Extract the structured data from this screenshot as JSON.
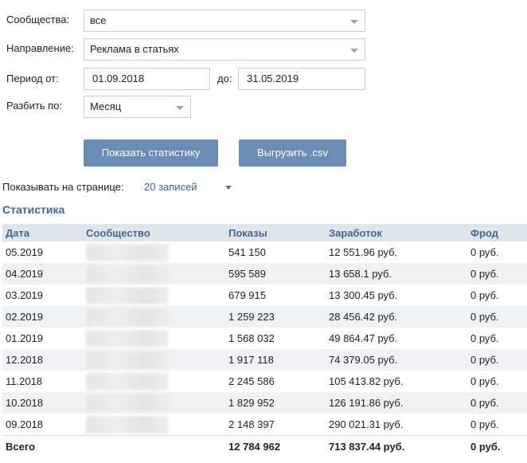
{
  "filters": {
    "communities": {
      "label": "Сообщества:",
      "value": "все"
    },
    "direction": {
      "label": "Направление:",
      "value": "Реклама в статьях"
    },
    "period": {
      "label": "Период от:",
      "from": "01.09.2018",
      "to_label": "до:",
      "to": "31.05.2019"
    },
    "split": {
      "label": "Разбить по:",
      "value": "Месяц"
    }
  },
  "actions": {
    "show_stats": "Показать статистику",
    "export_csv": "Выгрузить .csv"
  },
  "per_page": {
    "label": "Показывать на странице:",
    "value": "20 записей"
  },
  "stats": {
    "title": "Статистика",
    "columns": [
      "Дата",
      "Сообщество",
      "Показы",
      "Заработок",
      "Фрод"
    ],
    "rows": [
      {
        "date": "05.2019",
        "views": "541 150",
        "earnings": "12 551.96 руб.",
        "fraud": "0 руб."
      },
      {
        "date": "04.2019",
        "views": "595 589",
        "earnings": "13 658.1 руб.",
        "fraud": "0 руб."
      },
      {
        "date": "03.2019",
        "views": "679 915",
        "earnings": "13 300.45 руб.",
        "fraud": "0 руб."
      },
      {
        "date": "02.2019",
        "views": "1 259 223",
        "earnings": "28 456.42 руб.",
        "fraud": "0 руб."
      },
      {
        "date": "01.2019",
        "views": "1 568 032",
        "earnings": "49 864.47 руб.",
        "fraud": "0 руб."
      },
      {
        "date": "12.2018",
        "views": "1 917 118",
        "earnings": "74 379.05 руб.",
        "fraud": "0 руб."
      },
      {
        "date": "11.2018",
        "views": "2 245 586",
        "earnings": "105 413.82 руб.",
        "fraud": "0 руб."
      },
      {
        "date": "10.2018",
        "views": "1 829 952",
        "earnings": "126 191.86 руб.",
        "fraud": "0 руб."
      },
      {
        "date": "09.2018",
        "views": "2 148 397",
        "earnings": "290 021.31 руб.",
        "fraud": "0 руб."
      }
    ],
    "total": {
      "label": "Всего",
      "views": "12 784 962",
      "earnings": "713 837.44 руб.",
      "fraud": "0 руб."
    }
  },
  "colors": {
    "button": "#6b8cb5",
    "header_bg": "#dfe5ec",
    "accent": "#45678f",
    "row_alt": "#f0f2f5"
  }
}
